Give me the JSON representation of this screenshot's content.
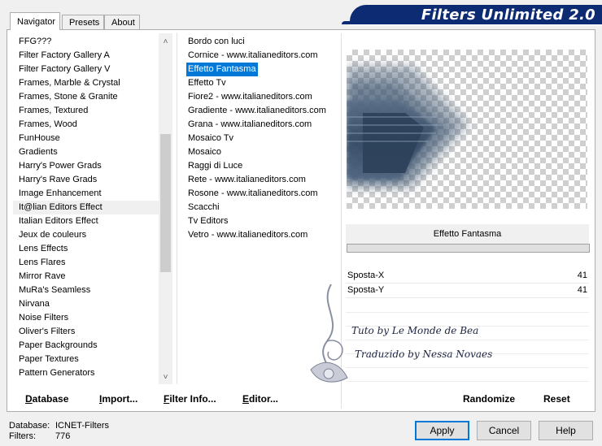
{
  "tabs": [
    {
      "label": "Navigator",
      "active": true
    },
    {
      "label": "Presets",
      "active": false
    },
    {
      "label": "About",
      "active": false
    }
  ],
  "app_title": "Filters Unlimited 2.0",
  "categories": [
    "FFG???",
    "Filter Factory Gallery A",
    "Filter Factory Gallery V",
    "Frames, Marble & Crystal",
    "Frames, Stone & Granite",
    "Frames, Textured",
    "Frames, Wood",
    "FunHouse",
    "Gradients",
    "Harry's Power Grads",
    "Harry's Rave Grads",
    "Image Enhancement",
    "It@lian Editors Effect",
    "Italian Editors Effect",
    "Jeux de couleurs",
    "Lens Effects",
    "Lens Flares",
    "Mirror Rave",
    "MuRa's Seamless",
    "Nirvana",
    "Noise Filters",
    "Oliver's Filters",
    "Paper Backgrounds",
    "Paper Textures",
    "Pattern Generators"
  ],
  "selected_category": "It@lian Editors Effect",
  "filters": [
    "Bordo con luci",
    "Cornice - www.italianeditors.com",
    "Effetto Fantasma",
    "Effetto Tv",
    "Fiore2 - www.italianeditors.com",
    "Gradiente - www.italianeditors.com",
    "Grana - www.italianeditors.com",
    "Mosaico Tv",
    "Mosaico",
    "Raggi di Luce",
    "Rete - www.italianeditors.com",
    "Rosone - www.italianeditors.com",
    "Scacchi",
    "Tv Editors",
    "Vetro - www.italianeditors.com"
  ],
  "selected_filter": "Effetto Fantasma",
  "effect_name": "Effetto Fantasma",
  "params": [
    {
      "label": "Sposta-X",
      "value": "41"
    },
    {
      "label": "Sposta-Y",
      "value": "41"
    }
  ],
  "watermark": {
    "line1": "Tuto by Le Monde de Bea",
    "line2": "Traduzido by Nessa Novaes"
  },
  "bottom_buttons": {
    "database": "Database",
    "import": "Import...",
    "filter_info": "Filter Info...",
    "editor": "Editor...",
    "randomize": "Randomize",
    "reset": "Reset"
  },
  "status": {
    "database_label": "Database:",
    "database_value": "ICNET-Filters",
    "filters_label": "Filters:",
    "filters_value": "776"
  },
  "dialog_buttons": {
    "apply": "Apply",
    "cancel": "Cancel",
    "help": "Help"
  },
  "colors": {
    "title_bar": "#0c2b73",
    "selection": "#0078d7"
  }
}
